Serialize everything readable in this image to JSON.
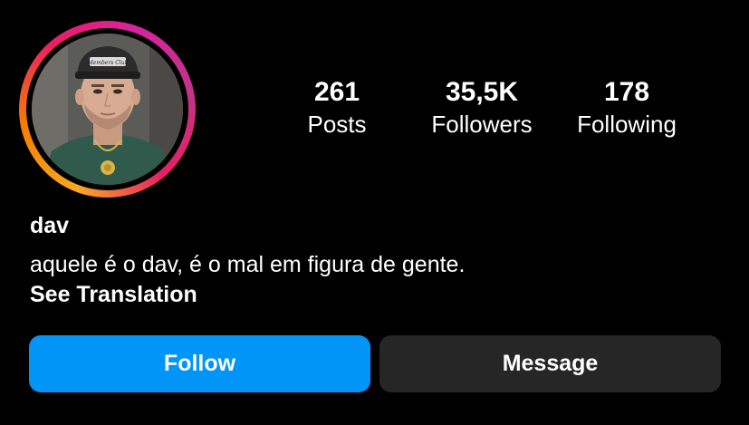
{
  "profile": {
    "username": "dav",
    "bio": "aquele é o dav, é o mal em figura de gente.",
    "see_translation": "See Translation",
    "avatar_cap_text": "Members Club"
  },
  "stats": {
    "posts": {
      "value": "261",
      "label": "Posts"
    },
    "followers": {
      "value": "35,5K",
      "label": "Followers"
    },
    "following": {
      "value": "178",
      "label": "Following"
    }
  },
  "actions": {
    "follow_label": "Follow",
    "message_label": "Message"
  },
  "colors": {
    "background": "#000000",
    "follow_button": "#0095f6",
    "message_button": "#262626",
    "story_ring": [
      "#f9a825",
      "#e91e63",
      "#c13584"
    ]
  }
}
